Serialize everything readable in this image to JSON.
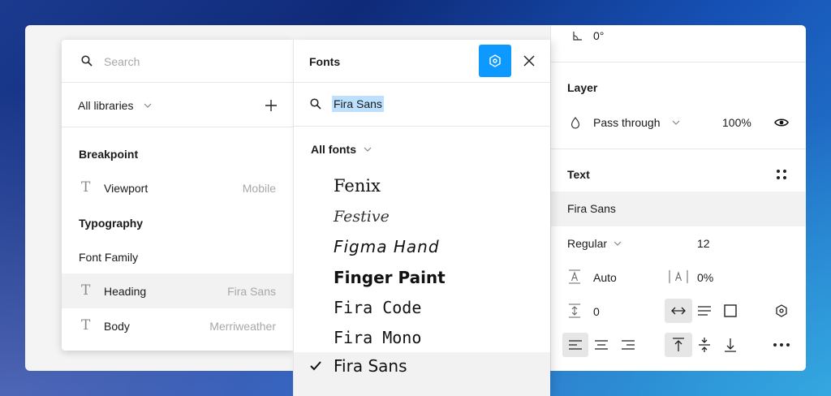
{
  "library": {
    "search_placeholder": "Search",
    "filter_label": "All libraries",
    "groups": [
      {
        "title": "Breakpoint"
      },
      {
        "title": "Typography"
      }
    ],
    "items": [
      {
        "label": "Viewport",
        "value": "Mobile"
      },
      {
        "label": "Font Family"
      },
      {
        "label": "Heading",
        "value": "Fira Sans"
      },
      {
        "label": "Body",
        "value": "Merriweather"
      }
    ]
  },
  "fonts_panel": {
    "title": "Fonts",
    "search_value": "Fira Sans",
    "filter_label": "All fonts",
    "fonts": [
      "Fenix",
      "Festive",
      "Figma Hand",
      "Finger Paint",
      "Fira Code",
      "Fira Mono",
      "Fira Sans"
    ],
    "selected_font": "Fira Sans",
    "accent_color": "#0d99ff"
  },
  "properties": {
    "rotation": "0°",
    "layer": {
      "title": "Layer",
      "blend_mode": "Pass through",
      "opacity": "100%"
    },
    "text": {
      "title": "Text",
      "font_family": "Fira Sans",
      "font_weight": "Regular",
      "font_size": "12",
      "line_height": "Auto",
      "letter_spacing": "0%",
      "paragraph_spacing": "0"
    }
  }
}
